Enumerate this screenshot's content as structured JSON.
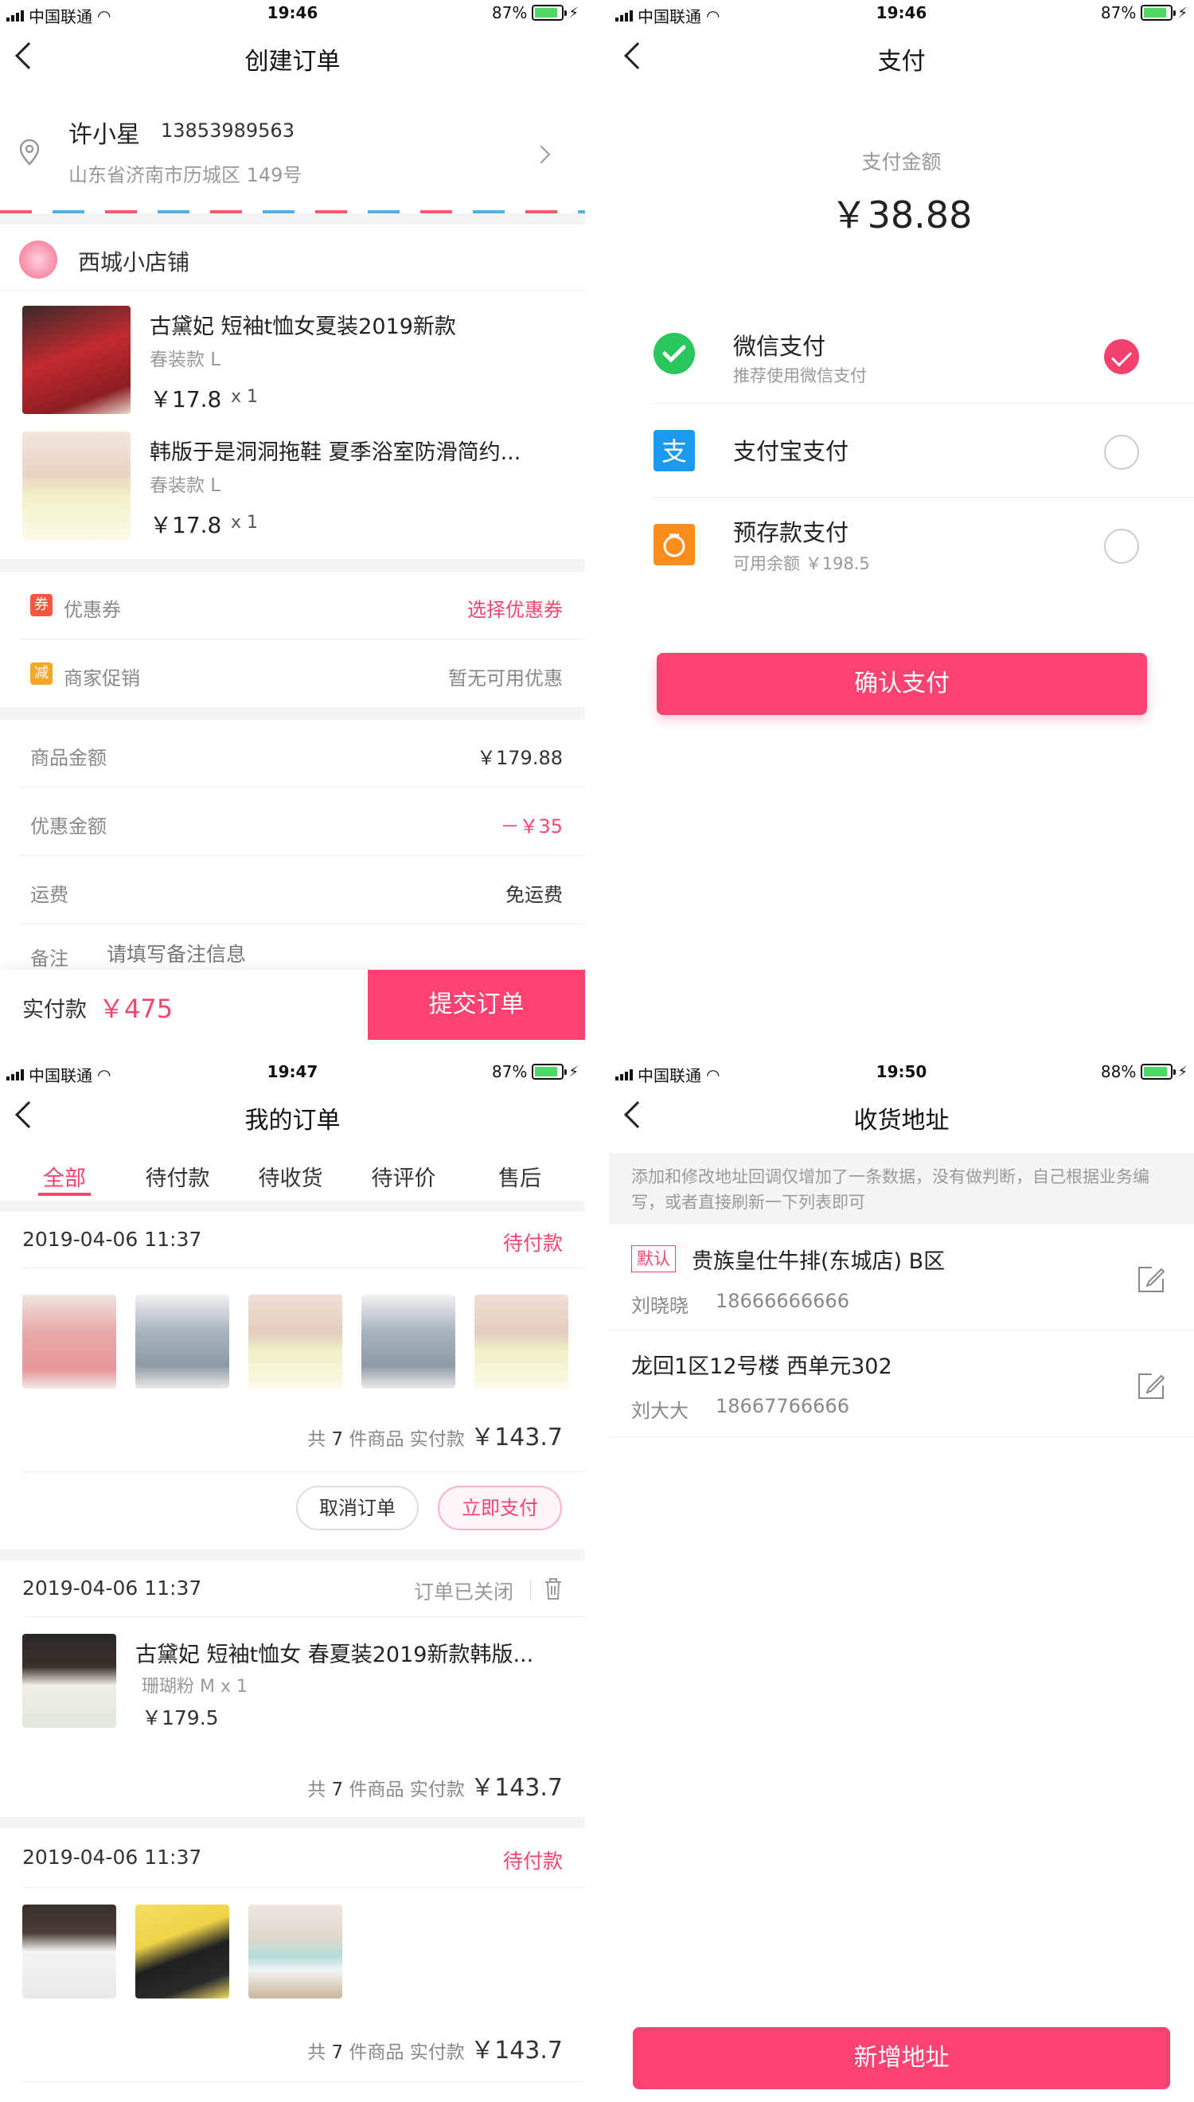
{
  "status_bars": [
    {
      "carrier": "中国联通",
      "time": "19:46",
      "battery": "87%"
    },
    {
      "carrier": "中国联通",
      "time": "19:46",
      "battery": "87%"
    },
    {
      "carrier": "中国联通",
      "time": "19:47",
      "battery": "87%"
    },
    {
      "carrier": "中国联通",
      "time": "19:50",
      "battery": "88%"
    }
  ],
  "create_order": {
    "title": "创建订单",
    "address": {
      "name": "许小星",
      "phone": "13853989563",
      "detail": "山东省济南市历城区 149号"
    },
    "shop": "西城小店铺",
    "items": [
      {
        "name": "古黛妃 短袖t恤女夏装2019新款",
        "spec": "春装款 L",
        "price": "￥17.8",
        "qty": "x 1"
      },
      {
        "name": "韩版于是洞洞拖鞋 夏季浴室防滑简约...",
        "spec": "春装款 L",
        "price": "￥17.8",
        "qty": "x 1"
      }
    ],
    "coupon": {
      "tag": "券",
      "label": "优惠券",
      "value": "选择优惠券"
    },
    "promo": {
      "tag": "减",
      "label": "商家促销",
      "value": "暂无可用优惠"
    },
    "goods_amount": {
      "label": "商品金额",
      "value": "￥179.88"
    },
    "discount": {
      "label": "优惠金额",
      "value": "－￥35"
    },
    "shipping": {
      "label": "运费",
      "value": "免运费"
    },
    "remark": {
      "label": "备注",
      "placeholder": "请填写备注信息"
    },
    "footer": {
      "label": "实付款",
      "amount": "￥475",
      "button": "提交订单"
    }
  },
  "payment": {
    "title": "支付",
    "amount_label": "支付金额",
    "amount": "￥38.88",
    "methods": [
      {
        "name": "微信支付",
        "sub": "推荐使用微信支付",
        "icon": "wechat-pay-icon",
        "selected": true
      },
      {
        "name": "支付宝支付",
        "sub": "",
        "icon": "alipay-icon",
        "selected": false
      },
      {
        "name": "预存款支付",
        "sub": "可用余额 ￥198.5",
        "icon": "prepaid-icon",
        "selected": false
      }
    ],
    "confirm": "确认支付"
  },
  "my_orders": {
    "title": "我的订单",
    "tabs": [
      "全部",
      "待付款",
      "待收货",
      "待评价",
      "售后"
    ],
    "active_tab": 0,
    "orders": [
      {
        "date": "2019-04-06 11:37",
        "status": "待付款",
        "summary_prefix": "共",
        "count": "7",
        "summary_mid": "件商品 实付款",
        "total": "￥143.7",
        "btn_cancel": "取消订单",
        "btn_pay": "立即支付"
      },
      {
        "date": "2019-04-06 11:37",
        "status": "订单已关闭",
        "item_name": "古黛妃 短袖t恤女 春夏装2019新款韩版...",
        "item_spec": "珊瑚粉 M x 1",
        "item_price": "￥179.5",
        "summary_prefix": "共",
        "count": "7",
        "summary_mid": "件商品 实付款",
        "total": "￥143.7"
      },
      {
        "date": "2019-04-06 11:37",
        "status": "待付款",
        "summary_prefix": "共",
        "count": "7",
        "summary_mid": "件商品 实付款",
        "total": "￥143.7"
      }
    ]
  },
  "addresses": {
    "title": "收货地址",
    "notice": "添加和修改地址回调仅增加了一条数据，没有做判断，自己根据业务编写，或者直接刷新一下列表即可",
    "list": [
      {
        "default_tag": "默认",
        "address": "贵族皇仕牛排(东城店) B区",
        "name": "刘晓晓",
        "phone": "18666666666"
      },
      {
        "default_tag": "",
        "address": "龙回1区12号楼 西单元302",
        "name": "刘大大",
        "phone": "18667766666"
      }
    ],
    "add_button": "新增地址"
  },
  "colors": {
    "accent": "#fb4271",
    "wechat": "#2bc65b",
    "alipay": "#1a9bf0",
    "prepaid": "#fb8c1e",
    "promo_tag": "#f5a623",
    "coupon_tag": "#f2583e"
  }
}
